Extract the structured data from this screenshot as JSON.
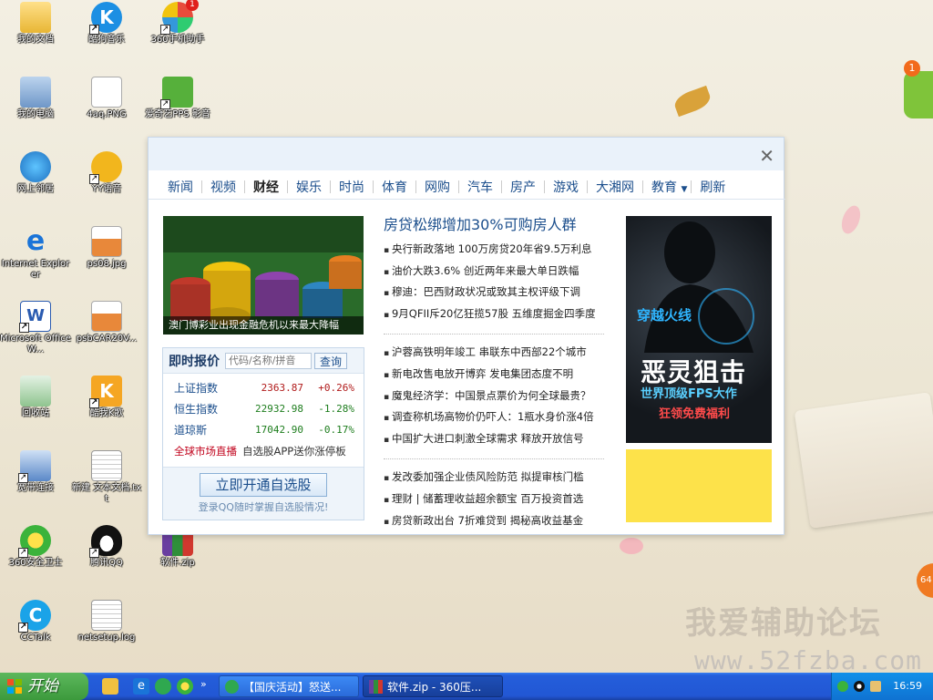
{
  "desktop": {
    "icons": [
      {
        "label": "我的文档"
      },
      {
        "label": "酷狗音乐"
      },
      {
        "label": "360手机助手",
        "badge": "1"
      },
      {
        "label": "我的电脑"
      },
      {
        "label": "4aq.PNG"
      },
      {
        "label": "爱奇艺PPS 影音"
      },
      {
        "label": "网上邻居"
      },
      {
        "label": "YY语音"
      },
      {
        "label": "Internet Explorer"
      },
      {
        "label": "ps08.jpg"
      },
      {
        "label": "Microsoft Office W..."
      },
      {
        "label": "psbCAR20V..."
      },
      {
        "label": "回收站"
      },
      {
        "label": "酷我K歌"
      },
      {
        "label": "宽带连接"
      },
      {
        "label": "新建 文本文档.txt"
      },
      {
        "label": "360安全卫士"
      },
      {
        "label": "腾讯QQ"
      },
      {
        "label": "软件.zip"
      },
      {
        "label": "CCTalk"
      },
      {
        "label": "netsetup.log"
      }
    ],
    "floating_badge": "1",
    "edge_badge": "64",
    "watermark_cn": "我爱辅助论坛",
    "watermark_url": "www.52fzba.com"
  },
  "popup": {
    "close": "✕",
    "nav": [
      "新闻",
      "视频",
      "财经",
      "娱乐",
      "时尚",
      "体育",
      "网购",
      "汽车",
      "房产",
      "游戏",
      "大湘网",
      "教育",
      "刷新"
    ],
    "nav_active": "财经",
    "hero_caption": "澳门博彩业出现金融危机以来最大降幅",
    "quote": {
      "title": "即时报价",
      "placeholder": "代码/名称/拼音",
      "search_label": "查询",
      "rows": [
        {
          "name": "上证指数",
          "value": "2363.87",
          "change": "+0.26%"
        },
        {
          "name": "恒生指数",
          "value": "22932.98",
          "change": "-1.28%"
        },
        {
          "name": "道琼斯",
          "value": "17042.90",
          "change": "-0.17%"
        }
      ],
      "live_red": "全球市场直播",
      "live_text": "自选股APP送你涨停板",
      "cta": "立即开通自选股",
      "tip": "登录QQ随时掌握自选股情况!"
    },
    "news": {
      "headline": "房贷松绑增加30%可购房人群",
      "group1": [
        "央行新政落地 100万房贷20年省9.5万利息",
        "油价大跌3.6% 创近两年来最大单日跌幅",
        "穆迪：巴西财政状况或致其主权评级下调",
        "9月QFII斥20亿狂揽57股 五维度掘金四季度"
      ],
      "group2": [
        "沪蓉高铁明年竣工 串联东中西部22个城市",
        "新电改售电放开博弈 发电集团态度不明",
        "魔鬼经济学：中国景点票价为何全球最贵？",
        "调查称机场高物价仍吓人：1瓶水身价涨4倍",
        "中国扩大进口刺激全球需求 释放开放信号"
      ],
      "group3": [
        "发改委加强企业债风险防范 拟提审核门槛",
        "理财 | 储蓄理收益超余额宝 百万投资首选",
        "房贷新政出台 7折难贷到 揭秘高收益基金"
      ]
    },
    "ad": {
      "logo": "穿越火线",
      "title": "恶灵狙击",
      "subtitle": "世界顶级FPS大作",
      "cta": "狂领免费福利"
    }
  },
  "taskbar": {
    "start": "开始",
    "tasks": [
      "【国庆活动】怒送...",
      "软件.zip - 360压..."
    ],
    "clock": "16:59"
  }
}
